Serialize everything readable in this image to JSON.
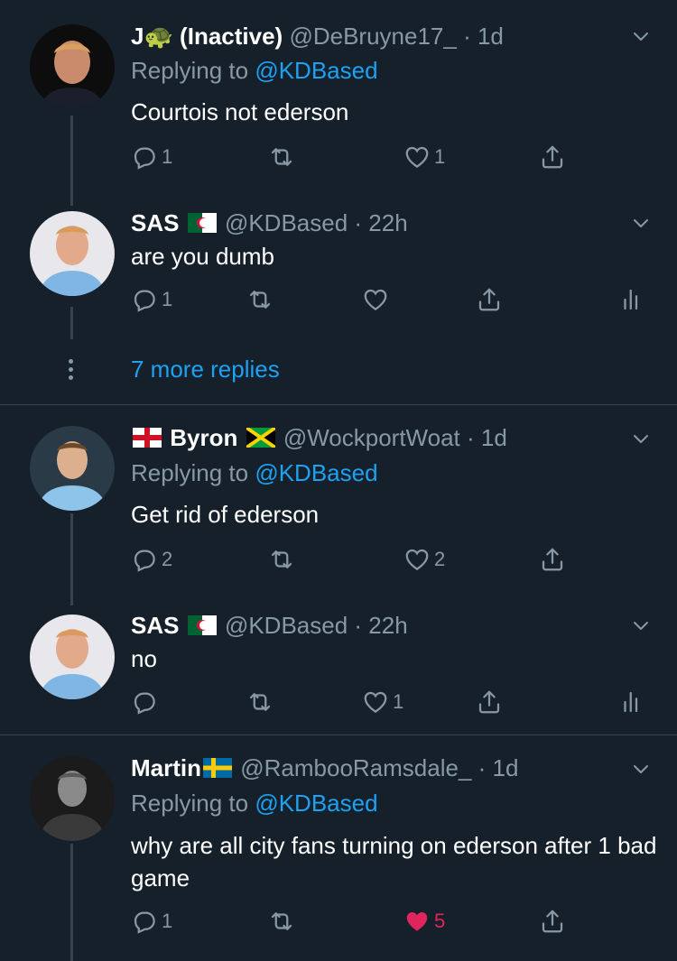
{
  "tweets": [
    {
      "name": "J🐢 (Inactive)",
      "handle": "@DeBruyne17_",
      "time": "· 1d",
      "replying_label": "Replying to",
      "replying_to": "@KDBased",
      "text": "Courtois not ederson",
      "replies": "1",
      "retweets": "",
      "likes": "1"
    },
    {
      "name": "SAS",
      "handle": "@KDBased",
      "time": "· 22h",
      "text": "are you dumb",
      "replies": "1",
      "retweets": "",
      "likes": ""
    },
    {
      "more_replies": "7 more replies"
    },
    {
      "name": "Byron",
      "handle": "@WockportWoat",
      "time": "· 1d",
      "replying_label": "Replying to",
      "replying_to": "@KDBased",
      "text": "Get rid of ederson",
      "replies": "2",
      "retweets": "",
      "likes": "2"
    },
    {
      "name": "SAS",
      "handle": "@KDBased",
      "time": "· 22h",
      "text": "no",
      "replies": "",
      "retweets": "",
      "likes": "1"
    },
    {
      "name": "Martin",
      "handle": "@RambooRamsdale_",
      "time": "· 1d",
      "replying_label": "Replying to",
      "replying_to": "@KDBased",
      "text": "why are all city fans turning on ederson after 1 bad game",
      "replies": "1",
      "retweets": "",
      "likes": "5"
    }
  ],
  "colors": {
    "background": "#15202b",
    "text": "#ffffff",
    "secondary": "#8899a6",
    "accent": "#1da1f2",
    "like": "#e0245e",
    "divider": "#38444d"
  }
}
